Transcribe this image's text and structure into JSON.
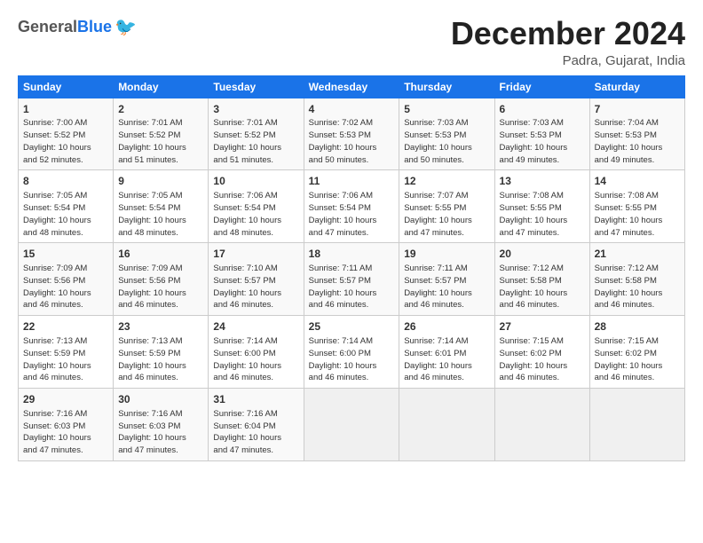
{
  "header": {
    "logo_general": "General",
    "logo_blue": "Blue",
    "month_title": "December 2024",
    "location": "Padra, Gujarat, India"
  },
  "weekdays": [
    "Sunday",
    "Monday",
    "Tuesday",
    "Wednesday",
    "Thursday",
    "Friday",
    "Saturday"
  ],
  "weeks": [
    [
      {
        "day": "1",
        "info": "Sunrise: 7:00 AM\nSunset: 5:52 PM\nDaylight: 10 hours\nand 52 minutes."
      },
      {
        "day": "2",
        "info": "Sunrise: 7:01 AM\nSunset: 5:52 PM\nDaylight: 10 hours\nand 51 minutes."
      },
      {
        "day": "3",
        "info": "Sunrise: 7:01 AM\nSunset: 5:52 PM\nDaylight: 10 hours\nand 51 minutes."
      },
      {
        "day": "4",
        "info": "Sunrise: 7:02 AM\nSunset: 5:53 PM\nDaylight: 10 hours\nand 50 minutes."
      },
      {
        "day": "5",
        "info": "Sunrise: 7:03 AM\nSunset: 5:53 PM\nDaylight: 10 hours\nand 50 minutes."
      },
      {
        "day": "6",
        "info": "Sunrise: 7:03 AM\nSunset: 5:53 PM\nDaylight: 10 hours\nand 49 minutes."
      },
      {
        "day": "7",
        "info": "Sunrise: 7:04 AM\nSunset: 5:53 PM\nDaylight: 10 hours\nand 49 minutes."
      }
    ],
    [
      {
        "day": "8",
        "info": "Sunrise: 7:05 AM\nSunset: 5:54 PM\nDaylight: 10 hours\nand 48 minutes."
      },
      {
        "day": "9",
        "info": "Sunrise: 7:05 AM\nSunset: 5:54 PM\nDaylight: 10 hours\nand 48 minutes."
      },
      {
        "day": "10",
        "info": "Sunrise: 7:06 AM\nSunset: 5:54 PM\nDaylight: 10 hours\nand 48 minutes."
      },
      {
        "day": "11",
        "info": "Sunrise: 7:06 AM\nSunset: 5:54 PM\nDaylight: 10 hours\nand 47 minutes."
      },
      {
        "day": "12",
        "info": "Sunrise: 7:07 AM\nSunset: 5:55 PM\nDaylight: 10 hours\nand 47 minutes."
      },
      {
        "day": "13",
        "info": "Sunrise: 7:08 AM\nSunset: 5:55 PM\nDaylight: 10 hours\nand 47 minutes."
      },
      {
        "day": "14",
        "info": "Sunrise: 7:08 AM\nSunset: 5:55 PM\nDaylight: 10 hours\nand 47 minutes."
      }
    ],
    [
      {
        "day": "15",
        "info": "Sunrise: 7:09 AM\nSunset: 5:56 PM\nDaylight: 10 hours\nand 46 minutes."
      },
      {
        "day": "16",
        "info": "Sunrise: 7:09 AM\nSunset: 5:56 PM\nDaylight: 10 hours\nand 46 minutes."
      },
      {
        "day": "17",
        "info": "Sunrise: 7:10 AM\nSunset: 5:57 PM\nDaylight: 10 hours\nand 46 minutes."
      },
      {
        "day": "18",
        "info": "Sunrise: 7:11 AM\nSunset: 5:57 PM\nDaylight: 10 hours\nand 46 minutes."
      },
      {
        "day": "19",
        "info": "Sunrise: 7:11 AM\nSunset: 5:57 PM\nDaylight: 10 hours\nand 46 minutes."
      },
      {
        "day": "20",
        "info": "Sunrise: 7:12 AM\nSunset: 5:58 PM\nDaylight: 10 hours\nand 46 minutes."
      },
      {
        "day": "21",
        "info": "Sunrise: 7:12 AM\nSunset: 5:58 PM\nDaylight: 10 hours\nand 46 minutes."
      }
    ],
    [
      {
        "day": "22",
        "info": "Sunrise: 7:13 AM\nSunset: 5:59 PM\nDaylight: 10 hours\nand 46 minutes."
      },
      {
        "day": "23",
        "info": "Sunrise: 7:13 AM\nSunset: 5:59 PM\nDaylight: 10 hours\nand 46 minutes."
      },
      {
        "day": "24",
        "info": "Sunrise: 7:14 AM\nSunset: 6:00 PM\nDaylight: 10 hours\nand 46 minutes."
      },
      {
        "day": "25",
        "info": "Sunrise: 7:14 AM\nSunset: 6:00 PM\nDaylight: 10 hours\nand 46 minutes."
      },
      {
        "day": "26",
        "info": "Sunrise: 7:14 AM\nSunset: 6:01 PM\nDaylight: 10 hours\nand 46 minutes."
      },
      {
        "day": "27",
        "info": "Sunrise: 7:15 AM\nSunset: 6:02 PM\nDaylight: 10 hours\nand 46 minutes."
      },
      {
        "day": "28",
        "info": "Sunrise: 7:15 AM\nSunset: 6:02 PM\nDaylight: 10 hours\nand 46 minutes."
      }
    ],
    [
      {
        "day": "29",
        "info": "Sunrise: 7:16 AM\nSunset: 6:03 PM\nDaylight: 10 hours\nand 47 minutes."
      },
      {
        "day": "30",
        "info": "Sunrise: 7:16 AM\nSunset: 6:03 PM\nDaylight: 10 hours\nand 47 minutes."
      },
      {
        "day": "31",
        "info": "Sunrise: 7:16 AM\nSunset: 6:04 PM\nDaylight: 10 hours\nand 47 minutes."
      },
      null,
      null,
      null,
      null
    ]
  ]
}
